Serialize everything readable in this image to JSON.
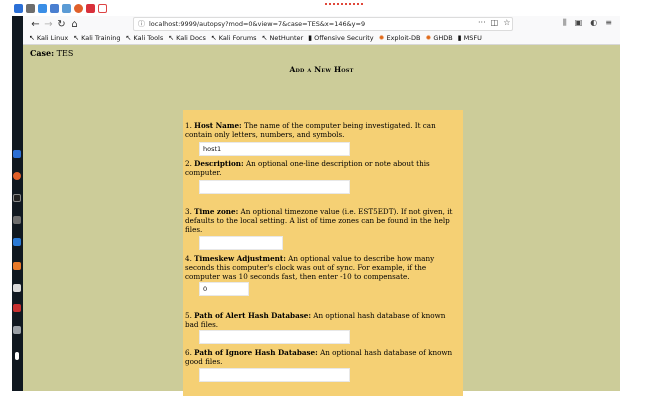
{
  "browser": {
    "url": "localhost:9999/autopsy?mod=0&view=7&case=TES&x=146&y=9",
    "nav_icons": [
      "back-icon",
      "forward-icon",
      "reload-icon",
      "home-icon"
    ],
    "url_right_icons": [
      "more-icon",
      "pocket-icon",
      "bookmark-star-icon"
    ],
    "toolbar_icons": [
      "library-icon",
      "sidebar-icon",
      "extension-icon",
      "menu-icon"
    ]
  },
  "bookmarks": [
    {
      "label": "Kali Linux",
      "icon": "kali-icon"
    },
    {
      "label": "Kali Training",
      "icon": "kali-icon"
    },
    {
      "label": "Kali Tools",
      "icon": "kali-icon"
    },
    {
      "label": "Kali Docs",
      "icon": "kali-icon"
    },
    {
      "label": "Kali Forums",
      "icon": "kali-icon"
    },
    {
      "label": "NetHunter",
      "icon": "kali-icon"
    },
    {
      "label": "Offensive Security",
      "icon": "offsec-icon"
    },
    {
      "label": "Exploit-DB",
      "icon": "exploitdb-icon"
    },
    {
      "label": "GHDB",
      "icon": "exploitdb-icon"
    },
    {
      "label": "MSFU",
      "icon": "offsec-icon"
    }
  ],
  "page": {
    "case_label": "Case:",
    "case_value": "TES",
    "title": "Add a New Host"
  },
  "form": {
    "host_name": {
      "num": "1.",
      "label": "Host Name:",
      "desc": "The name of the computer being investigated. It can contain only letters, numbers, and symbols.",
      "value": "host1"
    },
    "description": {
      "num": "2.",
      "label": "Description:",
      "desc": "An optional one-line description or note about this computer.",
      "value": ""
    },
    "time_zone": {
      "num": "3.",
      "label": "Time zone:",
      "desc": "An optional timezone value (i.e. EST5EDT). If not given, it defaults to the local setting. A list of time zones can be found in the help files.",
      "value": ""
    },
    "timeskew": {
      "num": "4.",
      "label": "Timeskew Adjustment:",
      "desc": "An optional value to describe how many seconds this computer's clock was out of sync. For example, if the computer was 10 seconds fast, then enter -10 to compensate.",
      "value": "0"
    },
    "alert_hash": {
      "num": "5.",
      "label": "Path of Alert Hash Database:",
      "desc": "An optional hash database of known bad files.",
      "value": ""
    },
    "ignore_hash": {
      "num": "6.",
      "label": "Path of Ignore Hash Database:",
      "desc": "An optional hash database of known good files.",
      "value": ""
    }
  },
  "colors": {
    "page_bg": "#cccc99",
    "form_bg": "#f5d074",
    "dock_bg": "#101820"
  }
}
